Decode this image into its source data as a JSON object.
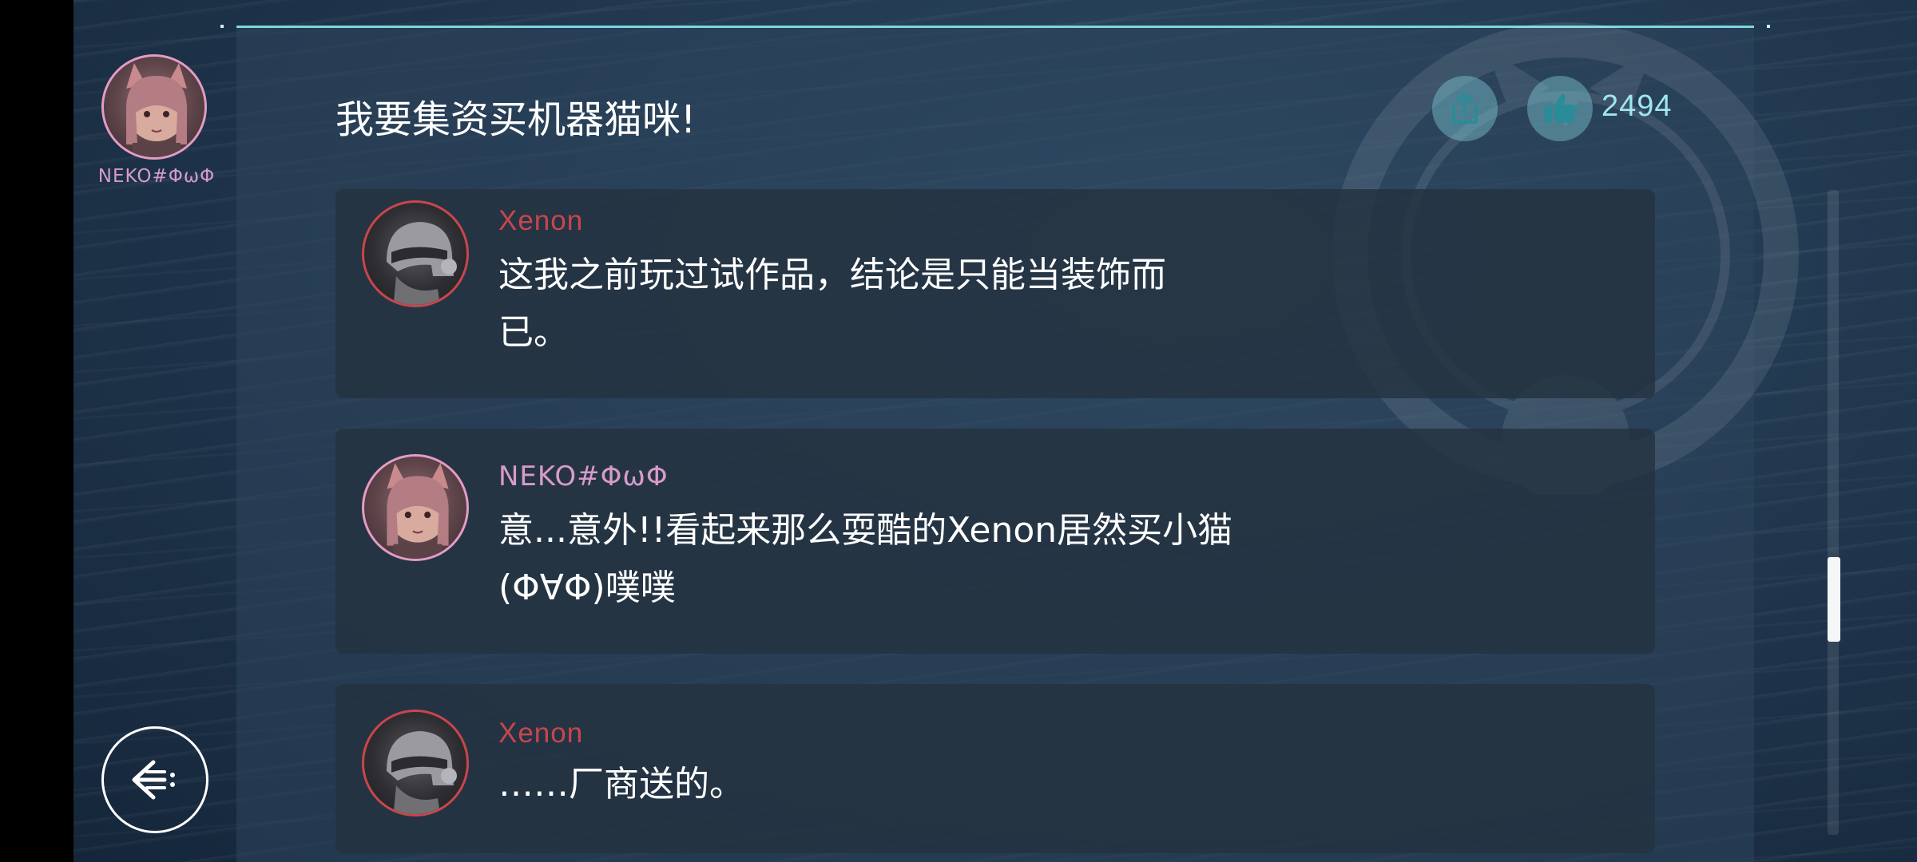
{
  "player": {
    "name": "NEKO#ΦωΦ"
  },
  "post": {
    "title": "我要集资买机器猫咪!",
    "like_count": "2494"
  },
  "comments": [
    {
      "author": "Xenon",
      "lines": [
        "这我之前玩过试作品，结论是只能当装饰而",
        "已。"
      ]
    },
    {
      "author": "NEKO#ΦωΦ",
      "lines": [
        "意...意外!!看起来那么耍酷的Xenon居然买小猫",
        "(Φ∀Φ)噗噗"
      ]
    },
    {
      "author": "Xenon",
      "lines": [
        "……厂商送的。"
      ]
    }
  ],
  "icons": {
    "share": "share-icon",
    "like": "thumbs-up-icon",
    "back": "back-arrow-icon"
  },
  "colors": {
    "accent": "#7fd6df",
    "xenon": "#c8464c",
    "neko": "#d69bcb"
  },
  "scroll_position": 0.6
}
